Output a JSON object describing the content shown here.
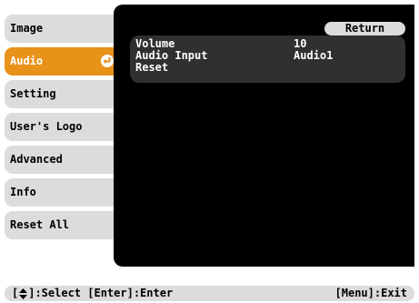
{
  "menu": {
    "items": [
      {
        "label": "Image"
      },
      {
        "label": "Audio"
      },
      {
        "label": "Setting"
      },
      {
        "label": "User's Logo"
      },
      {
        "label": "Advanced"
      },
      {
        "label": "Info"
      },
      {
        "label": "Reset All"
      }
    ],
    "active_index": 1
  },
  "submenu": {
    "return_label": "Return",
    "rows": [
      {
        "label": "Volume",
        "value": "10"
      },
      {
        "label": "Audio Input",
        "value": "Audio1"
      },
      {
        "label": "Reset",
        "value": ""
      }
    ]
  },
  "footer": {
    "bracket_open": "[",
    "select_text": "]:Select [Enter]:Enter",
    "menu_exit": "[Menu]:Exit"
  },
  "colors": {
    "active_tab": "#e8921a",
    "tab": "#dcdcdc",
    "panel": "#000000",
    "submenu": "#303030"
  },
  "icons": {
    "active_item": "enter-icon",
    "footer": "up-down-arrows-icon"
  }
}
